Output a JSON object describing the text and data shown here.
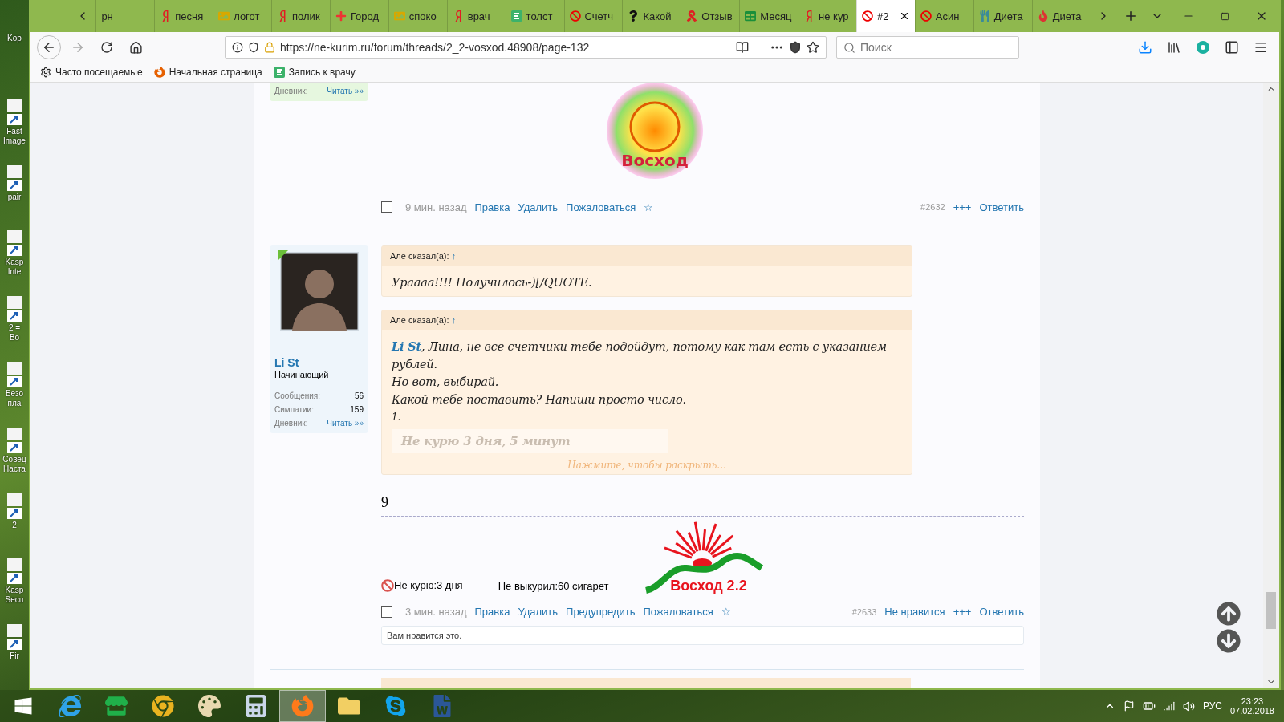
{
  "desktop_icons": [
    {
      "lines": [
        "Kop"
      ],
      "kind": "none"
    },
    {
      "lines": [
        "Fast",
        "Image"
      ],
      "kind": "shortcut"
    },
    {
      "lines": [
        "pair"
      ],
      "kind": "shortcut"
    },
    {
      "lines": [
        "Kasp",
        "Inte"
      ],
      "kind": "shortcut"
    },
    {
      "lines": [
        "2 =",
        "Bo"
      ],
      "kind": "shortcut"
    },
    {
      "lines": [
        "Безо",
        "пла"
      ],
      "kind": "shortcut"
    },
    {
      "lines": [
        "Совец",
        "Наста"
      ],
      "kind": "shortcut"
    },
    {
      "lines": [
        "2"
      ],
      "kind": "shortcut"
    },
    {
      "lines": [
        "Kasp",
        "Secu"
      ],
      "kind": "shortcut"
    },
    {
      "lines": [
        "Fir"
      ],
      "kind": "shortcut"
    }
  ],
  "browser": {
    "tabs": [
      {
        "label": "рн",
        "kind": "none",
        "selected": false
      },
      {
        "label": "песня",
        "kind": "yandex",
        "selected": false
      },
      {
        "label": "логот",
        "kind": "image",
        "selected": false
      },
      {
        "label": "полик",
        "kind": "yandex",
        "selected": false
      },
      {
        "label": "Город",
        "kind": "cross",
        "selected": false
      },
      {
        "label": "споко",
        "kind": "image",
        "selected": false
      },
      {
        "label": "врач",
        "kind": "yandex",
        "selected": false
      },
      {
        "label": "толст",
        "kind": "square",
        "selected": false
      },
      {
        "label": "Счетч",
        "kind": "stop",
        "selected": false
      },
      {
        "label": "Какой",
        "kind": "question",
        "selected": false
      },
      {
        "label": "Отзыв",
        "kind": "ribbon",
        "selected": false
      },
      {
        "label": "Месяц",
        "kind": "sheet",
        "selected": false
      },
      {
        "label": "не кур",
        "kind": "yandex",
        "selected": false
      },
      {
        "label": "#2",
        "kind": "stop",
        "selected": true
      },
      {
        "label": "Асин",
        "kind": "stop",
        "selected": false
      },
      {
        "label": "Диета",
        "kind": "bowl",
        "selected": false
      },
      {
        "label": "Диета",
        "kind": "flame",
        "selected": false
      }
    ],
    "url": "https://ne-kurim.ru/forum/threads/2_2-vosxod.48908/page-132",
    "search": {
      "placeholder": "Поиск"
    },
    "bookmarks": [
      {
        "label": "Часто посещаемые",
        "kind": "gear"
      },
      {
        "label": "Начальная страница",
        "kind": "firefox"
      },
      {
        "label": "Запись к врачу",
        "kind": "square"
      }
    ]
  },
  "forum": {
    "prev_post": {
      "user_stats": [
        {
          "label": "Дневник:",
          "value": "Читать »»"
        }
      ],
      "signature_logo": "Восход",
      "footer": {
        "checked": false,
        "time": "9 мин. назад",
        "actions": [
          "Правка",
          "Удалить",
          "Пожаловаться"
        ],
        "star": "☆",
        "number": "#2632",
        "right_actions": [
          "+++",
          "Ответить"
        ]
      }
    },
    "post": {
      "user": {
        "name": "Li St",
        "title": "Начинающий",
        "online": true,
        "stats": [
          {
            "label": "Сообщения:",
            "value": "56"
          },
          {
            "label": "Симпатии:",
            "value": "159"
          },
          {
            "label": "Дневник:",
            "value": "Читать »»"
          }
        ]
      },
      "quotes": [
        {
          "author": "Але сказал(а):",
          "arrow": "↑",
          "lines": [
            "Ураааа!!!! Получилось-)[/QUOTE."
          ]
        },
        {
          "author": "Але сказал(а):",
          "arrow": "↑",
          "lines": [
            "**Li St**, Лина, не все счетчики тебе подойдут, потому как там есть с указанием рублей.",
            "Но вот, выбирай.",
            "Какой тебе поставить? Напиши просто число.",
            "1."
          ],
          "faded_counter": "Не курю  3 дня, 5 минут",
          "expand": "Нажмите, чтобы раскрыть..."
        }
      ],
      "reply": "9",
      "counters": [
        {
          "kind": "no-smoking",
          "label": "Не курю:",
          "value": "3 дня"
        },
        {
          "kind": "plain",
          "label": "Не выкурил:",
          "value": "60 сигарет"
        }
      ],
      "signature_logo": "Восход 2.2",
      "footer": {
        "checked": false,
        "time": "3 мин. назад",
        "actions": [
          "Правка",
          "Удалить",
          "Предупредить",
          "Пожаловаться"
        ],
        "star": "☆",
        "number": "#2633",
        "right_actions": [
          "Не нравится",
          "+++",
          "Ответить"
        ]
      },
      "likes": "Вам нравится это."
    }
  },
  "taskbar": {
    "apps": [
      {
        "kind": "ie",
        "active": false
      },
      {
        "kind": "store",
        "active": false
      },
      {
        "kind": "chrome",
        "active": false
      },
      {
        "kind": "paint",
        "active": false
      },
      {
        "kind": "calc",
        "active": false
      },
      {
        "kind": "firefox",
        "active": true
      },
      {
        "kind": "folder",
        "active": false
      },
      {
        "kind": "skype",
        "active": false
      },
      {
        "kind": "word",
        "active": false
      }
    ],
    "language": "РУС",
    "time": "23:23",
    "date": "07.02.2018"
  }
}
